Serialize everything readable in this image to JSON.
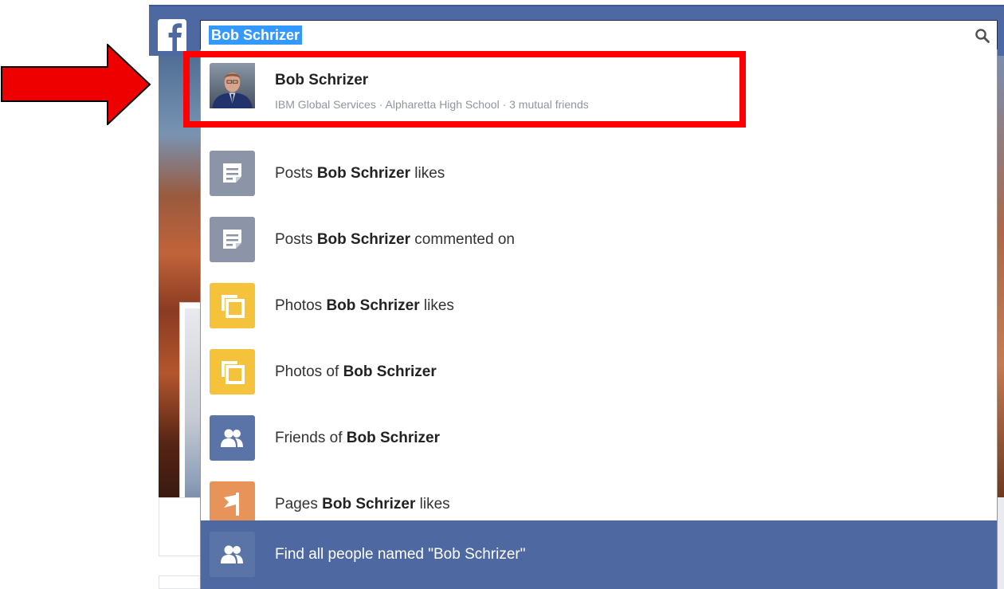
{
  "search": {
    "query": "Bob Schrizer"
  },
  "top_result": {
    "name": "Bob Schrizer",
    "meta": "IBM Global Services · Alpharetta High School · 3 mutual friends"
  },
  "suggestions": [
    {
      "prefix": "Posts ",
      "name": "Bob Schrizer",
      "suffix": " likes",
      "icon": "posts-icon",
      "color": "#8c95a8"
    },
    {
      "prefix": "Posts ",
      "name": "Bob Schrizer",
      "suffix": " commented on",
      "icon": "posts-icon",
      "color": "#8c95a8"
    },
    {
      "prefix": "Photos ",
      "name": "Bob Schrizer",
      "suffix": " likes",
      "icon": "photos-icon",
      "color": "#f5c33b"
    },
    {
      "prefix": "Photos of ",
      "name": "Bob Schrizer",
      "suffix": "",
      "icon": "photos-icon",
      "color": "#f5c33b"
    },
    {
      "prefix": "Friends of ",
      "name": "Bob Schrizer",
      "suffix": "",
      "icon": "friends-icon",
      "color": "#5b74a8"
    },
    {
      "prefix": "Pages ",
      "name": "Bob Schrizer",
      "suffix": " likes",
      "icon": "pages-flag-icon",
      "color": "#e8935a"
    }
  ],
  "find_all": {
    "label": "Find all people named \"Bob Schrizer\"",
    "icon": "friends-icon"
  },
  "colors": {
    "facebook_blue": "#4e69a2",
    "highlight_red": "#ff0000",
    "posts_gray": "#8c95a8",
    "photos_yellow": "#f5c33b",
    "pages_orange": "#e8935a"
  }
}
